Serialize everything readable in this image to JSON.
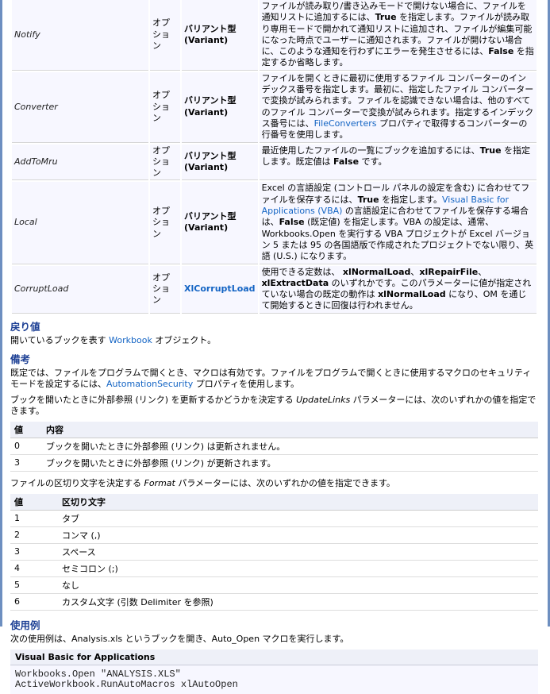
{
  "params": [
    {
      "name": "Notify",
      "opt": "オプション",
      "type": "バリアント型 (Variant)",
      "type_link": false,
      "desc": [
        {
          "t": "ファイルが読み取り/書き込みモードで開けない場合に、ファイルを通知リストに追加するには、"
        },
        {
          "t": "True",
          "s": "b"
        },
        {
          "t": " を指定します。ファイルが読み取り専用モードで開かれて通知リストに追加され、ファイルが編集可能になった時点でユーザーに通知されます。ファイルが開けない場合に、このような通知を行わずにエラーを発生させるには、"
        },
        {
          "t": "False",
          "s": "b"
        },
        {
          "t": " を指定するか省略します。"
        }
      ]
    },
    {
      "name": "Converter",
      "opt": "オプション",
      "type": "バリアント型 (Variant)",
      "type_link": false,
      "desc": [
        {
          "t": "ファイルを開くときに最初に使用するファイル コンバーターのインデックス番号を指定します。最初に、指定したファイル コンバーターで変換が試みられます。ファイルを認識できない場合は、他のすべてのファイル コンバーターで変換が試みられます。指定するインデックス番号には、"
        },
        {
          "t": "FileConverters",
          "s": "link"
        },
        {
          "t": " プロパティで取得するコンバーターの行番号を使用します。"
        }
      ]
    },
    {
      "name": "AddToMru",
      "opt": "オプション",
      "type": "バリアント型 (Variant)",
      "type_link": false,
      "desc": [
        {
          "t": "最近使用したファイルの一覧にブックを追加するには、"
        },
        {
          "t": "True",
          "s": "b"
        },
        {
          "t": " を指定します。既定値は "
        },
        {
          "t": "False",
          "s": "b"
        },
        {
          "t": " です。"
        }
      ]
    },
    {
      "name": "Local",
      "opt": "オプション",
      "type": "バリアント型 (Variant)",
      "type_link": false,
      "desc": [
        {
          "t": "Excel の言語設定 (コントロール パネルの設定を含む) に合わせてファイルを保存するには、"
        },
        {
          "t": "True",
          "s": "b"
        },
        {
          "t": " を指定します。"
        },
        {
          "t": "Visual Basic for Applications (VBA)",
          "s": "linkl"
        },
        {
          "t": " の言語設定に合わせてファイルを保存する場合は、"
        },
        {
          "t": "False",
          "s": "b"
        },
        {
          "t": " (既定値) を指定します。VBA の設定は、通常、Workbooks.Open を実行する VBA プロジェクトが Excel バージョン 5 または 95 の各国語版で作成されたプロジェクトでない限り、英語 (U.S.) になります。"
        }
      ]
    },
    {
      "name": "CorruptLoad",
      "opt": "オプション",
      "type": "XlCorruptLoad",
      "type_link": true,
      "desc": [
        {
          "t": "使用できる定数は、 "
        },
        {
          "t": "xlNormalLoad",
          "s": "b"
        },
        {
          "t": "、"
        },
        {
          "t": "xlRepairFile",
          "s": "b"
        },
        {
          "t": "、"
        },
        {
          "t": "xlExtractData",
          "s": "b"
        },
        {
          "t": " のいずれかです。このパラメーターに値が指定されていない場合の既定の動作は "
        },
        {
          "t": "xlNormalLoad",
          "s": "b"
        },
        {
          "t": " になり、OM を通じて開始するときに回復は行われません。"
        }
      ]
    }
  ],
  "return": {
    "heading": "戻り値",
    "text": [
      {
        "t": "開いているブックを表す "
      },
      {
        "t": "Workbook",
        "s": "link"
      },
      {
        "t": " オブジェクト。"
      }
    ]
  },
  "remarks": {
    "heading": "備考",
    "p1": [
      {
        "t": "既定では、ファイルをプログラムで開くとき、マクロは有効です。ファイルをプログラムで開くときに使用するマクロのセキュリティ モードを設定するには、"
      },
      {
        "t": "AutomationSecurity",
        "s": "link"
      },
      {
        "t": " プロパティを使用します。"
      }
    ],
    "p2": [
      {
        "t": "ブックを開いたときに外部参照 (リンク) を更新するかどうかを決定する "
      },
      {
        "t": "UpdateLinks",
        "s": "i"
      },
      {
        "t": " パラメーターには、次のいずれかの値を指定できます。"
      }
    ],
    "t1": {
      "headers": [
        "値",
        "内容"
      ],
      "rows": [
        [
          "0",
          "ブックを開いたときに外部参照 (リンク) は更新されません。"
        ],
        [
          "3",
          "ブックを開いたときに外部参照 (リンク) が更新されます。"
        ]
      ]
    },
    "p3": [
      {
        "t": "ファイルの区切り文字を決定する "
      },
      {
        "t": "Format",
        "s": "i"
      },
      {
        "t": " パラメーターには、次のいずれかの値を指定できます。"
      }
    ],
    "t2": {
      "headers": [
        "値",
        "区切り文字"
      ],
      "rows": [
        [
          "1",
          "タブ"
        ],
        [
          "2",
          "コンマ (,)"
        ],
        [
          "3",
          "スペース"
        ],
        [
          "4",
          "セミコロン (;)"
        ],
        [
          "5",
          "なし"
        ],
        [
          "6",
          "カスタム文字 (引数 Delimiter を参照)"
        ]
      ]
    }
  },
  "example": {
    "heading": "使用例",
    "text": "次の使用例は、Analysis.xls というブックを開き、Auto_Open マクロを実行します。",
    "code_lang": "Visual Basic for Applications",
    "code": "Workbooks.Open \"ANALYSIS.XLS\"\nActiveWorkbook.RunAutoMacros xlAutoOpen"
  }
}
